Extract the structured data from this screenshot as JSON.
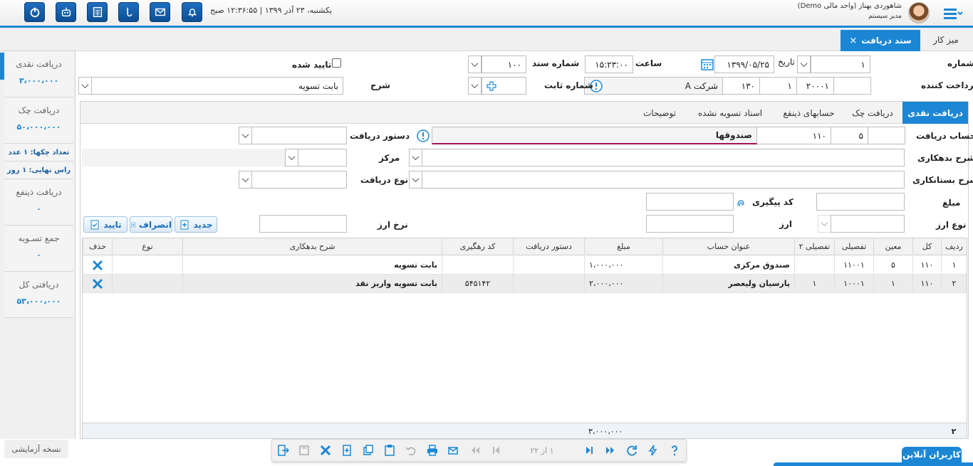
{
  "header": {
    "datetime": "یکشنبه، ۲۳ آذر ۱۳۹۹ | ۱۲:۳۶:۵۵ صبح",
    "user_name": "شاهوردی بهناز (واحد مالی Demo)",
    "user_role": "مدیر سیستم",
    "buttons": [
      "power-icon",
      "robot-icon",
      "calculator-icon",
      "usb-icon",
      "mail-icon",
      "bell-icon"
    ]
  },
  "tabs": {
    "desk": "میز کار",
    "doc": "سند دریافت",
    "doc_close": "×"
  },
  "sidebar": {
    "cash_title": "دریافت نقدی",
    "cash_value": "۳،۰۰۰،۰۰۰",
    "check_title": "دریافت چک",
    "check_value": "۵۰،۰۰۰،۰۰۰",
    "check_count": "تعداد چکها: ۱ عدد",
    "maturity": "راس نهایی: ۱ روز",
    "beneficiary_title": "دریافت ذینفع",
    "beneficiary_value": "۰",
    "settlement_title": "جمع تسـویه",
    "settlement_value": "۰",
    "total_title": "دریافتی کل",
    "total_value": "۵۳،۰۰۰،۰۰۰",
    "trial": "نسخه آزمایشی"
  },
  "form": {
    "number_label": "شماره",
    "number_value": "۱",
    "date_label": "تاریخ",
    "date_value": "۱۳۹۹/۰۵/۲۵",
    "time_label": "ساعت",
    "time_value": "۱۵:۲۳:۰۰",
    "docno_label": "شماره سند",
    "docno_value": "۱۰۰",
    "approved_label": "تایید شده",
    "payer_label": "پرداخت کننده",
    "payer_code1": "۲۰۰۰۱",
    "payer_code2": "۱",
    "payer_code3": "۱۳۰",
    "payer_name": "شرکت A",
    "fixed_no_label": "شماره ثابت",
    "desc_label": "شرح",
    "desc_value": "بابت تسویه"
  },
  "subtabs": [
    "دریافت نقدی",
    "دریافت چک",
    "حسابهای ذینفع",
    "اسناد تسویه نشده",
    "توضیحات"
  ],
  "detail": {
    "account_label": "حساب دریافت",
    "account_code2": "۵",
    "account_code3": "۱۱۰",
    "account_name": "صندوقها",
    "order_label": "دستور دریافت",
    "debit_desc_label": "شرح بدهکاری",
    "center_label": "مرکز",
    "credit_desc_label": "شرح بستانکاری",
    "type_label": "نوع دریافت",
    "amount_label": "مبلغ",
    "tracking_label": "کد پیگیری",
    "currency_type_label": "نوع ارز",
    "currency_label": "ارز",
    "rate_label": "نرخ ارز",
    "new_btn": "جدید",
    "cancel_btn": "انصراف",
    "confirm_btn": "تایید"
  },
  "grid": {
    "columns": [
      "ردیف",
      "کل",
      "معین",
      "تفصیلی",
      "تفصیلی ۲",
      "عنوان حساب",
      "مبلغ",
      "دستور دریافت",
      "کد رهگیری",
      "شرح بدهکاری",
      "نوع",
      "حذف"
    ],
    "rows": [
      {
        "row": "۱",
        "kol": "۱۱۰",
        "moein": "۵",
        "tafsili": "۱۱۰۰۱",
        "tafsili2": "",
        "title": "صندوق مرکزی",
        "amount": "۱،۰۰۰،۰۰۰",
        "order": "",
        "tracking": "",
        "desc": "بابت تسویه",
        "type": ""
      },
      {
        "row": "۲",
        "kol": "۱۱۰",
        "moein": "۱",
        "tafsili": "۱۰۰۰۱",
        "tafsili2": "۱",
        "title": "پارسیان ولیعصر",
        "amount": "۲،۰۰۰،۰۰۰",
        "order": "",
        "tracking": "۵۴۵۱۴۲",
        "desc": "بابت تسویه واریز نقد",
        "type": ""
      }
    ],
    "footer_count": "۲",
    "footer_sum": "۳،۰۰۰،۰۰۰"
  },
  "toolbar": {
    "pager": "۱ از ۲۲",
    "online_users": "کاربران آنلاین"
  }
}
